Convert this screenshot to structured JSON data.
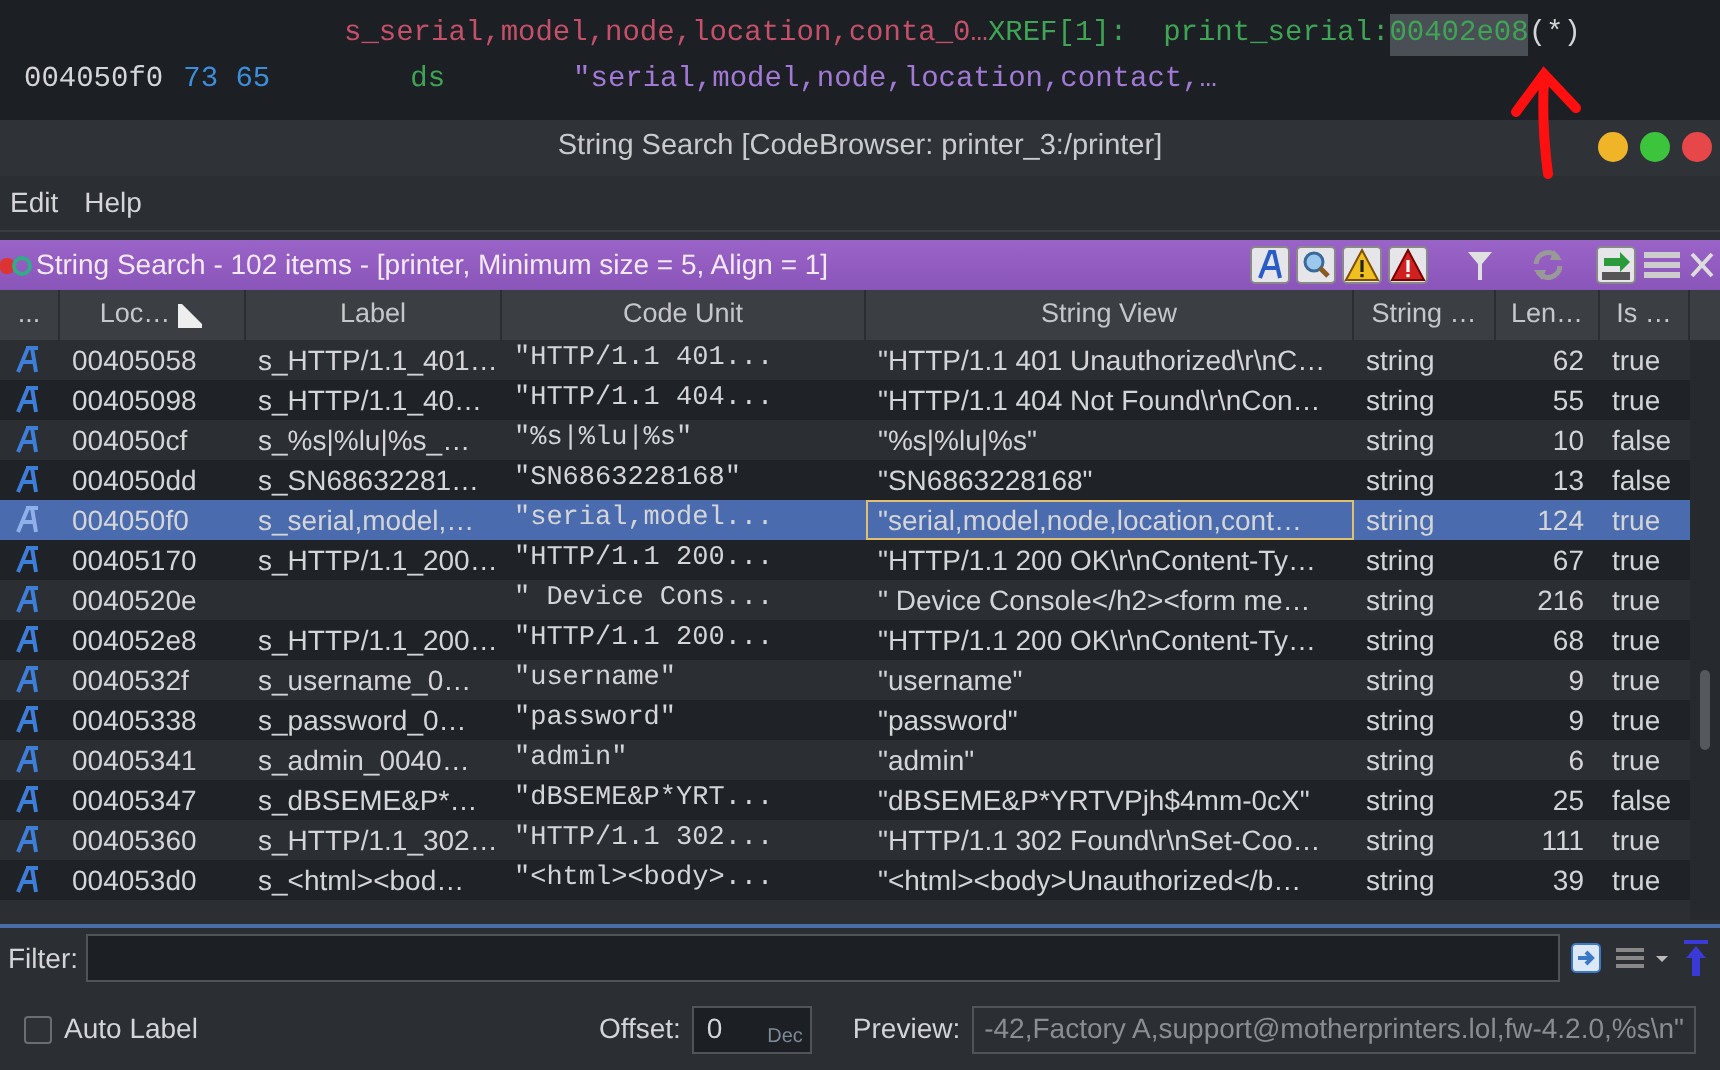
{
  "listing": {
    "label": "s_serial,model,node,location,conta_0…",
    "xref": "XREF[1]:",
    "xref_from": "print_serial:",
    "xref_addr": "00402e08",
    "xref_addr_highlighted": true,
    "xref_suffix": "(*)",
    "address": "004050f0",
    "bytes": "73 65",
    "mnemonic": "ds",
    "operand": "\"serial,model,node,location,contact,…"
  },
  "window": {
    "title": "String Search [CodeBrowser: printer_3:/printer]"
  },
  "menu": [
    "Edit",
    "Help"
  ],
  "panel": {
    "title": "String Search - 102 items - [printer, Minimum size = 5, Align = 1]"
  },
  "table": {
    "columns": [
      {
        "label": "...",
        "sorted": false
      },
      {
        "label": "Loc…",
        "sorted": true
      },
      {
        "label": "Label",
        "sorted": false
      },
      {
        "label": "Code Unit",
        "sorted": false
      },
      {
        "label": "String View",
        "sorted": false
      },
      {
        "label": "String …",
        "sorted": false
      },
      {
        "label": "Len…",
        "sorted": false
      },
      {
        "label": "Is …",
        "sorted": false
      }
    ],
    "rows": [
      {
        "location": "00405058",
        "label": "s_HTTP/1.1_401…",
        "code_unit": "\"HTTP/1.1 401...",
        "string_view": "\"HTTP/1.1 401 Unauthorized\\r\\nC…",
        "type": "string",
        "length": "62",
        "is": "true",
        "selected": false,
        "focused": false
      },
      {
        "location": "00405098",
        "label": "s_HTTP/1.1_40…",
        "code_unit": "\"HTTP/1.1 404...",
        "string_view": "\"HTTP/1.1 404 Not Found\\r\\nCon…",
        "type": "string",
        "length": "55",
        "is": "true",
        "selected": false,
        "focused": false
      },
      {
        "location": "004050cf",
        "label": "s_%s|%lu|%s_…",
        "code_unit": "\"%s|%lu|%s\"",
        "string_view": "\"%s|%lu|%s\"",
        "type": "string",
        "length": "10",
        "is": "false",
        "selected": false,
        "focused": false
      },
      {
        "location": "004050dd",
        "label": "s_SN68632281…",
        "code_unit": "\"SN6863228168\"",
        "string_view": "\"SN6863228168\"",
        "type": "string",
        "length": "13",
        "is": "false",
        "selected": false,
        "focused": false
      },
      {
        "location": "004050f0",
        "label": "s_serial,model,…",
        "code_unit": "\"serial,model...",
        "string_view": "\"serial,model,node,location,cont…",
        "type": "string",
        "length": "124",
        "is": "true",
        "selected": true,
        "focused": true
      },
      {
        "location": "00405170",
        "label": "s_HTTP/1.1_200…",
        "code_unit": "\"HTTP/1.1 200...",
        "string_view": "\"HTTP/1.1 200 OK\\r\\nContent-Ty…",
        "type": "string",
        "length": "67",
        "is": "true",
        "selected": false,
        "focused": false
      },
      {
        "location": "0040520e",
        "code_unit": "\" Device Cons...",
        "string_view": "\" Device Console</h2><form me…",
        "type": "string",
        "length": "216",
        "is": "true",
        "selected": false,
        "focused": false
      },
      {
        "location": "004052e8",
        "label": "s_HTTP/1.1_200…",
        "code_unit": "\"HTTP/1.1 200...",
        "string_view": "\"HTTP/1.1 200 OK\\r\\nContent-Ty…",
        "type": "string",
        "length": "68",
        "is": "true",
        "selected": false,
        "focused": false
      },
      {
        "location": "0040532f",
        "label": "s_username_0…",
        "code_unit": "\"username\"",
        "string_view": "\"username\"",
        "type": "string",
        "length": "9",
        "is": "true",
        "selected": false,
        "focused": false
      },
      {
        "location": "00405338",
        "label": "s_password_0…",
        "code_unit": "\"password\"",
        "string_view": "\"password\"",
        "type": "string",
        "length": "9",
        "is": "true",
        "selected": false,
        "focused": false
      },
      {
        "location": "00405341",
        "label": "s_admin_0040…",
        "code_unit": "\"admin\"",
        "string_view": "\"admin\"",
        "type": "string",
        "length": "6",
        "is": "true",
        "selected": false,
        "focused": false
      },
      {
        "location": "00405347",
        "label": "s_dBSEME&P*…",
        "code_unit": "\"dBSEME&P*YRT...",
        "string_view": "\"dBSEME&P*YRTVPjh$4mm-0cX\"",
        "type": "string",
        "length": "25",
        "is": "false",
        "selected": false,
        "focused": false
      },
      {
        "location": "00405360",
        "label": "s_HTTP/1.1_302…",
        "code_unit": "\"HTTP/1.1 302...",
        "string_view": "\"HTTP/1.1 302 Found\\r\\nSet-Coo…",
        "type": "string",
        "length": "111",
        "is": "true",
        "selected": false,
        "focused": false
      },
      {
        "location": "004053d0",
        "label": "s_<html><bod…",
        "code_unit": "\"<html><body>...",
        "string_view": "\"<html><body>Unauthorized</b…",
        "type": "string",
        "length": "39",
        "is": "true",
        "selected": false,
        "focused": false
      }
    ]
  },
  "filter": {
    "label": "Filter:"
  },
  "options": {
    "auto_label": {
      "label": "Auto Label",
      "checked": false
    },
    "offset": {
      "label": "Offset:",
      "value": "0",
      "radix": "Dec"
    },
    "preview": {
      "label": "Preview:",
      "value": "-42,Factory A,support@motherprinters.lol,fw-4.2.0,%s\\n\""
    }
  }
}
